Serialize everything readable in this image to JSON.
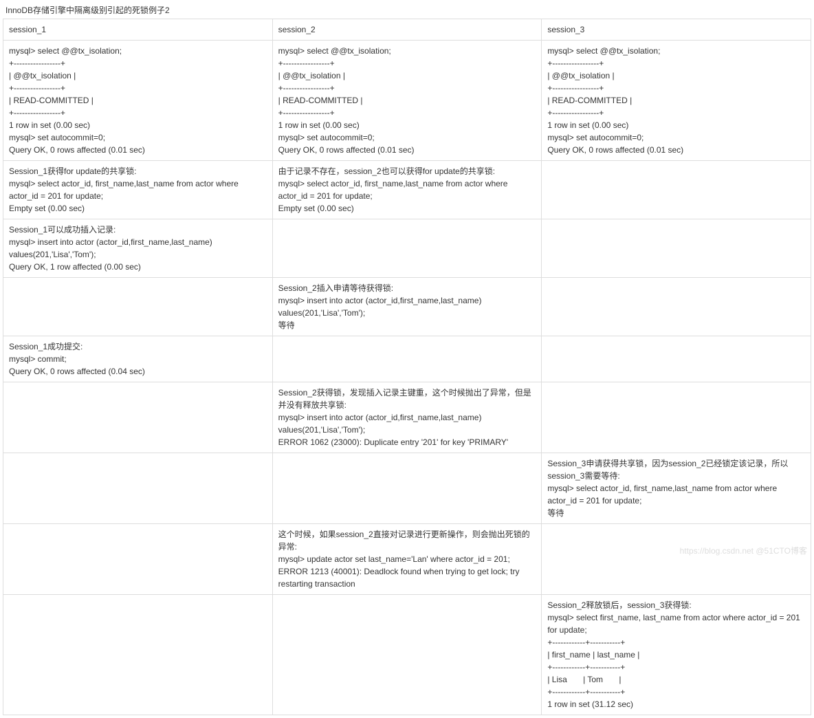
{
  "title": "InnoDB存储引擎中隔离级别引起的死锁例子2",
  "headers": [
    "session_1",
    "session_2",
    "session_3"
  ],
  "rows": [
    [
      "mysql> select @@tx_isolation;\n+-----------------+\n| @@tx_isolation |\n+-----------------+\n| READ-COMMITTED |\n+-----------------+\n1 row in set (0.00 sec)\nmysql> set autocommit=0;\nQuery OK, 0 rows affected (0.01 sec)",
      "mysql> select @@tx_isolation;\n+-----------------+\n| @@tx_isolation |\n+-----------------+\n| READ-COMMITTED |\n+-----------------+\n1 row in set (0.00 sec)\nmysql> set autocommit=0;\nQuery OK, 0 rows affected (0.01 sec)",
      "mysql> select @@tx_isolation;\n+-----------------+\n| @@tx_isolation |\n+-----------------+\n| READ-COMMITTED |\n+-----------------+\n1 row in set (0.00 sec)\nmysql> set autocommit=0;\nQuery OK, 0 rows affected (0.01 sec)"
    ],
    [
      "Session_1获得for update的共享锁:\nmysql> select actor_id, first_name,last_name from actor where actor_id = 201 for update;\nEmpty set (0.00 sec)",
      "由于记录不存在，session_2也可以获得for update的共享锁:\nmysql> select actor_id, first_name,last_name from actor where actor_id = 201 for update;\nEmpty set (0.00 sec)",
      ""
    ],
    [
      "Session_1可以成功插入记录:\nmysql> insert into actor (actor_id,first_name,last_name) values(201,'Lisa','Tom');\nQuery OK, 1 row affected (0.00 sec)",
      "",
      ""
    ],
    [
      "",
      "Session_2插入申请等待获得锁:\nmysql> insert into actor (actor_id,first_name,last_name) values(201,'Lisa','Tom');\n等待",
      ""
    ],
    [
      "Session_1成功提交:\nmysql> commit;\nQuery OK, 0 rows affected (0.04 sec)",
      "",
      ""
    ],
    [
      "",
      "Session_2获得锁，发现插入记录主键重，这个时候抛出了异常，但是并没有释放共享锁:\nmysql> insert into actor (actor_id,first_name,last_name) values(201,'Lisa','Tom');\nERROR 1062 (23000): Duplicate entry '201' for key 'PRIMARY'",
      ""
    ],
    [
      "",
      "",
      "Session_3申请获得共享锁，因为session_2已经锁定该记录，所以session_3需要等待:\nmysql> select actor_id, first_name,last_name from actor where actor_id = 201 for update;\n等待"
    ],
    [
      "",
      "这个时候，如果session_2直接对记录进行更新操作，则会抛出死锁的异常:\nmysql> update actor set last_name='Lan' where actor_id = 201;\nERROR 1213 (40001): Deadlock found when trying to get lock; try restarting transaction",
      ""
    ],
    [
      "",
      "",
      "Session_2释放锁后，session_3获得锁:\nmysql> select first_name, last_name from actor where actor_id = 201 for update;\n+------------+-----------+\n| first_name | last_name |\n+------------+-----------+\n| Lisa       | Tom       |\n+------------+-----------+\n1 row in set (31.12 sec)"
    ]
  ],
  "watermark": "https://blog.csdn.net  @51CTO博客"
}
